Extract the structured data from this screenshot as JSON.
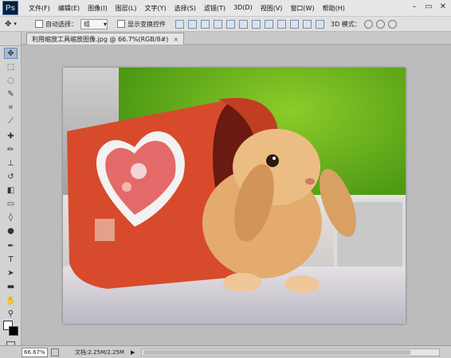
{
  "app": {
    "logo": "Ps"
  },
  "menu": [
    "文件(F)",
    "编辑(E)",
    "图像(I)",
    "图层(L)",
    "文字(Y)",
    "选择(S)",
    "滤镜(T)",
    "3D(D)",
    "视图(V)",
    "窗口(W)",
    "帮助(H)"
  ],
  "window_controls": {
    "minimize": "–",
    "restore": "▭",
    "close": "✕"
  },
  "options": {
    "auto_select_label": "自动选择：",
    "auto_select_value": "组",
    "show_transform_label": "显示变换控件",
    "mode_3d_label": "3D 模式："
  },
  "document": {
    "tab_title": "利用缩放工具缩放图像.jpg @ 66.7%(RGB/8#)",
    "tab_close": "×"
  },
  "status": {
    "zoom": "66.67%",
    "doc_info": "文档:2.25M/2.25M",
    "arrow": "▶"
  },
  "colors": {
    "accent": "#3f76b6",
    "foreground": "#ffffff",
    "background": "#000000"
  }
}
